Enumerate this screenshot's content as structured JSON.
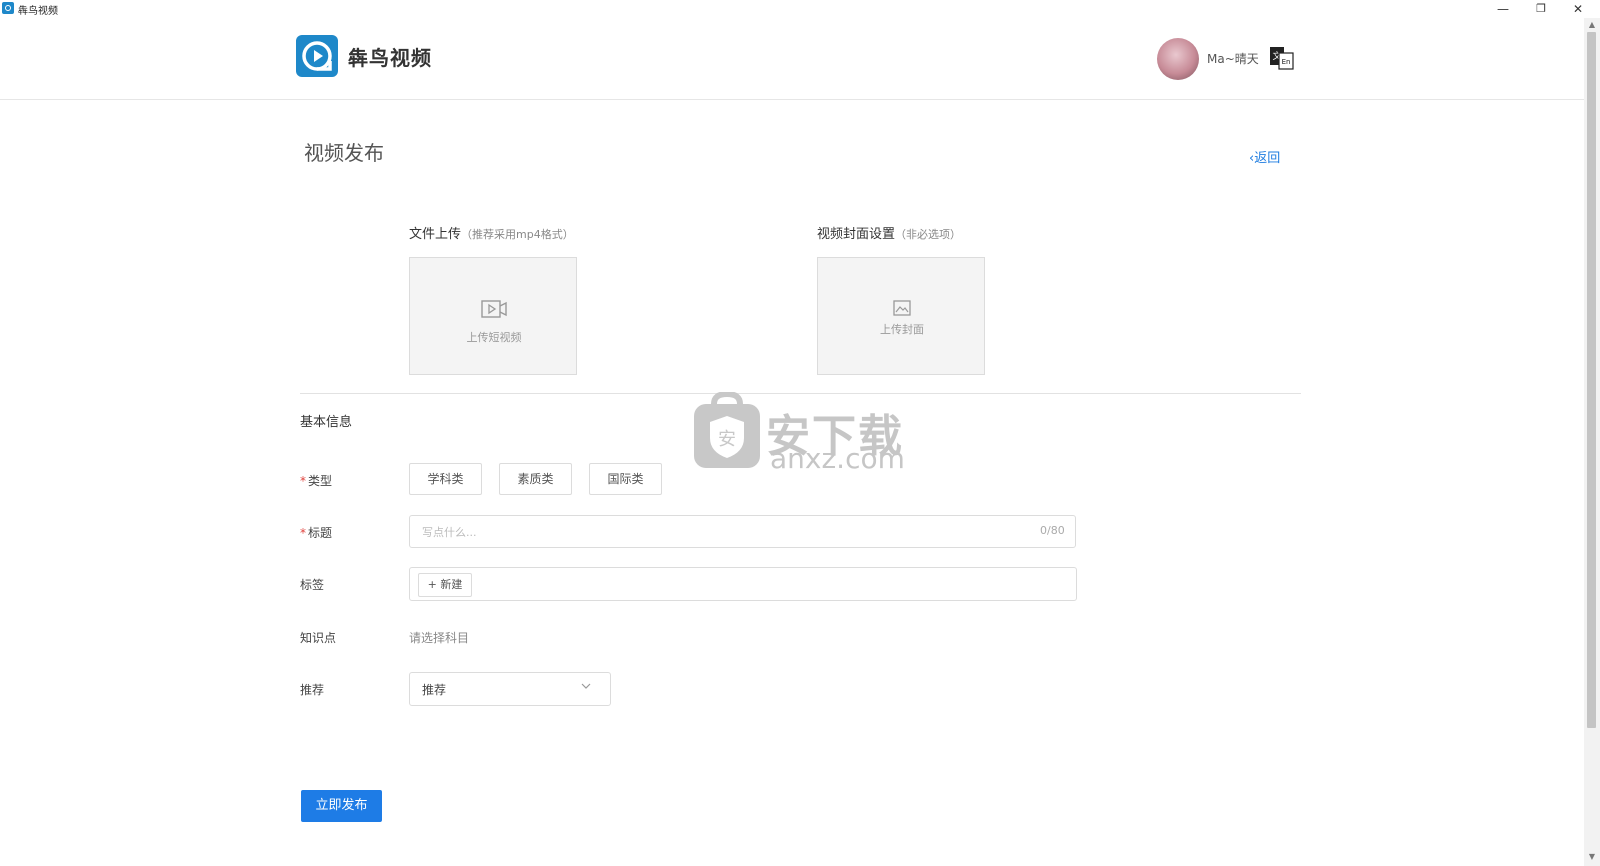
{
  "window": {
    "title": "犇鸟视频",
    "controls": {
      "minimize": "—",
      "restore": "❐",
      "close": "✕"
    }
  },
  "header": {
    "app_name": "犇鸟视频",
    "user_name": "Ma~晴天",
    "lang_icon_text": {
      "zh": "文",
      "en": "En"
    }
  },
  "page": {
    "title": "视频发布",
    "back_label": "返回"
  },
  "uploads": {
    "video": {
      "label": "文件上传",
      "hint": "（推荐采用mp4格式）",
      "button_text": "上传短视频",
      "icon": "video-icon"
    },
    "cover": {
      "label": "视频封面设置",
      "hint": "（非必选项）",
      "button_text": "上传封面",
      "icon": "image-icon"
    }
  },
  "basic_info": {
    "heading": "基本信息",
    "required_mark": "*",
    "type": {
      "label": "类型",
      "options": [
        "学科类",
        "素质类",
        "国际类"
      ]
    },
    "title_field": {
      "label": "标题",
      "placeholder": "写点什么...",
      "counter": "0/80"
    },
    "tags": {
      "label": "标签",
      "new_button": "+ 新建"
    },
    "knowledge": {
      "label": "知识点",
      "value": "请选择科目"
    },
    "recommend": {
      "label": "推荐",
      "selected": "推荐"
    }
  },
  "actions": {
    "publish": "立即发布"
  },
  "watermark": {
    "cn": "安下载",
    "en": "anxz.com",
    "shield_glyph": "安"
  },
  "colors": {
    "accent": "#1e7ce6",
    "required": "#e0443e",
    "brand": "#1e88c9"
  }
}
